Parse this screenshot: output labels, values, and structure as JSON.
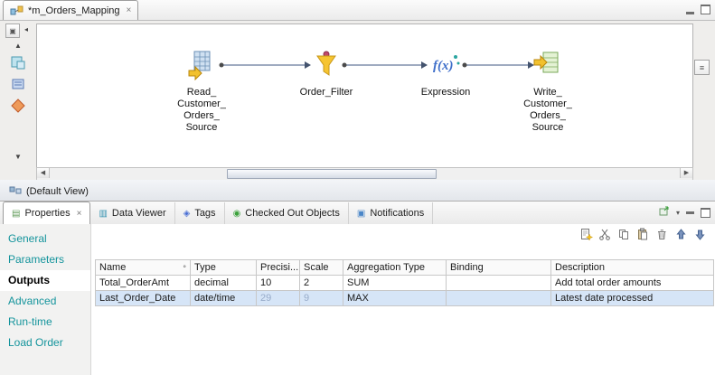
{
  "editor": {
    "tab_title": "*m_Orders_Mapping",
    "view_tab_label": "(Default View)",
    "nodes": [
      {
        "label": "Read_\nCustomer_\nOrders_\nSource"
      },
      {
        "label": "Order_Filter"
      },
      {
        "label": "Expression"
      },
      {
        "label": "Write_\nCustomer_\nOrders_\nSource"
      }
    ]
  },
  "glyphs": {
    "close": "×",
    "scroll_up": "▲",
    "scroll_down": "▼",
    "scroll_left": "◀",
    "scroll_right": "▶",
    "collapse_left": "◂",
    "menu_down": "▾",
    "outline": "≡",
    "palette_toggle": "▣",
    "sort": "°"
  },
  "properties_panel": {
    "tabs": [
      {
        "label": "Properties",
        "icon_glyph": "▤"
      },
      {
        "label": "Data Viewer",
        "icon_glyph": "▥"
      },
      {
        "label": "Tags",
        "icon_glyph": "◈"
      },
      {
        "label": "Checked Out Objects",
        "icon_glyph": "◉"
      },
      {
        "label": "Notifications",
        "icon_glyph": "▣"
      }
    ],
    "sidebar_items": [
      "General",
      "Parameters",
      "Outputs",
      "Advanced",
      "Run-time",
      "Load Order"
    ],
    "selected_sidebar": "Outputs",
    "table": {
      "columns": [
        "Name",
        "Type",
        "Precisi...",
        "Scale",
        "Aggregation Type",
        "Binding",
        "Description"
      ],
      "rows": [
        {
          "name": "Total_OrderAmt",
          "type": "decimal",
          "precision": "10",
          "scale": "2",
          "aggregation_type": "SUM",
          "binding": "",
          "description": "Add total order amounts"
        },
        {
          "name": "Last_Order_Date",
          "type": "date/time",
          "precision": "29",
          "scale": "9",
          "aggregation_type": "MAX",
          "binding": "",
          "description": "Latest date processed"
        }
      ]
    }
  },
  "colors": {
    "accent_teal": "#14949c",
    "selected_row": "#d6e5f7",
    "muted_value": "#97abc9"
  }
}
